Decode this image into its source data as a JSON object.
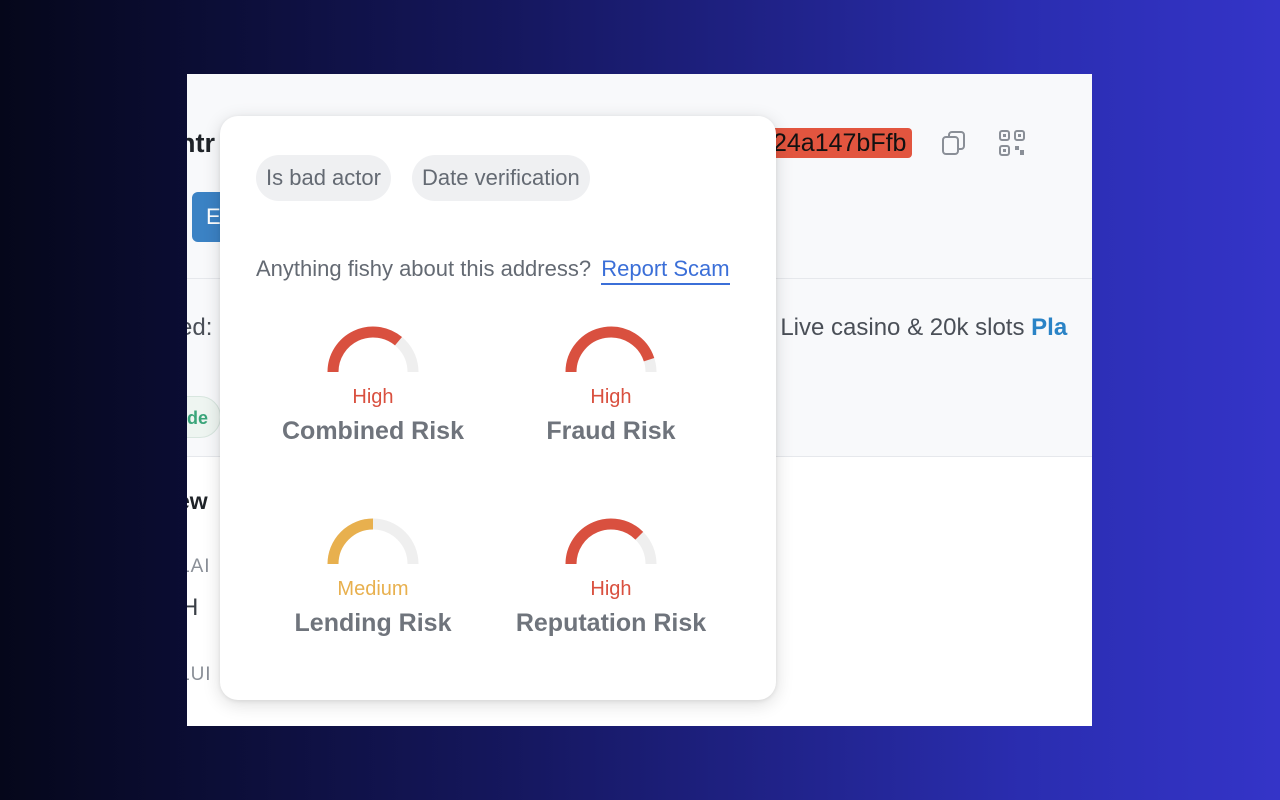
{
  "background_page": {
    "title_fragment": "ntr",
    "address_fragment": "24a147bFfb",
    "button_fragment": "E",
    "ad_label": "ed:",
    "ad_text": "! Live casino & 20k slots",
    "ad_link": "Pla",
    "badge_fragment": "de",
    "section_fragment": "ew",
    "balance_label_fragment": "LAI",
    "balance_value_fragment": "H",
    "value_label_fragment": "LUI",
    "icons": [
      "copy-icon",
      "qr-code-icon"
    ],
    "colors": {
      "address_highlight": "#e2553f",
      "link": "#2a83c6"
    }
  },
  "popover": {
    "chips": [
      "Is bad actor",
      "Date verification"
    ],
    "fishy_prompt": "Anything fishy about this address?",
    "report_link": "Report Scam",
    "risks": [
      {
        "level": "High",
        "name": "Combined Risk",
        "fill_fraction": 0.72,
        "color": "#d9503f"
      },
      {
        "level": "High",
        "name": "Fraud Risk",
        "fill_fraction": 0.9,
        "color": "#d9503f"
      },
      {
        "level": "Medium",
        "name": "Lending Risk",
        "fill_fraction": 0.5,
        "color": "#e8b04e"
      },
      {
        "level": "High",
        "name": "Reputation Risk",
        "fill_fraction": 0.75,
        "color": "#d9503f"
      }
    ]
  }
}
